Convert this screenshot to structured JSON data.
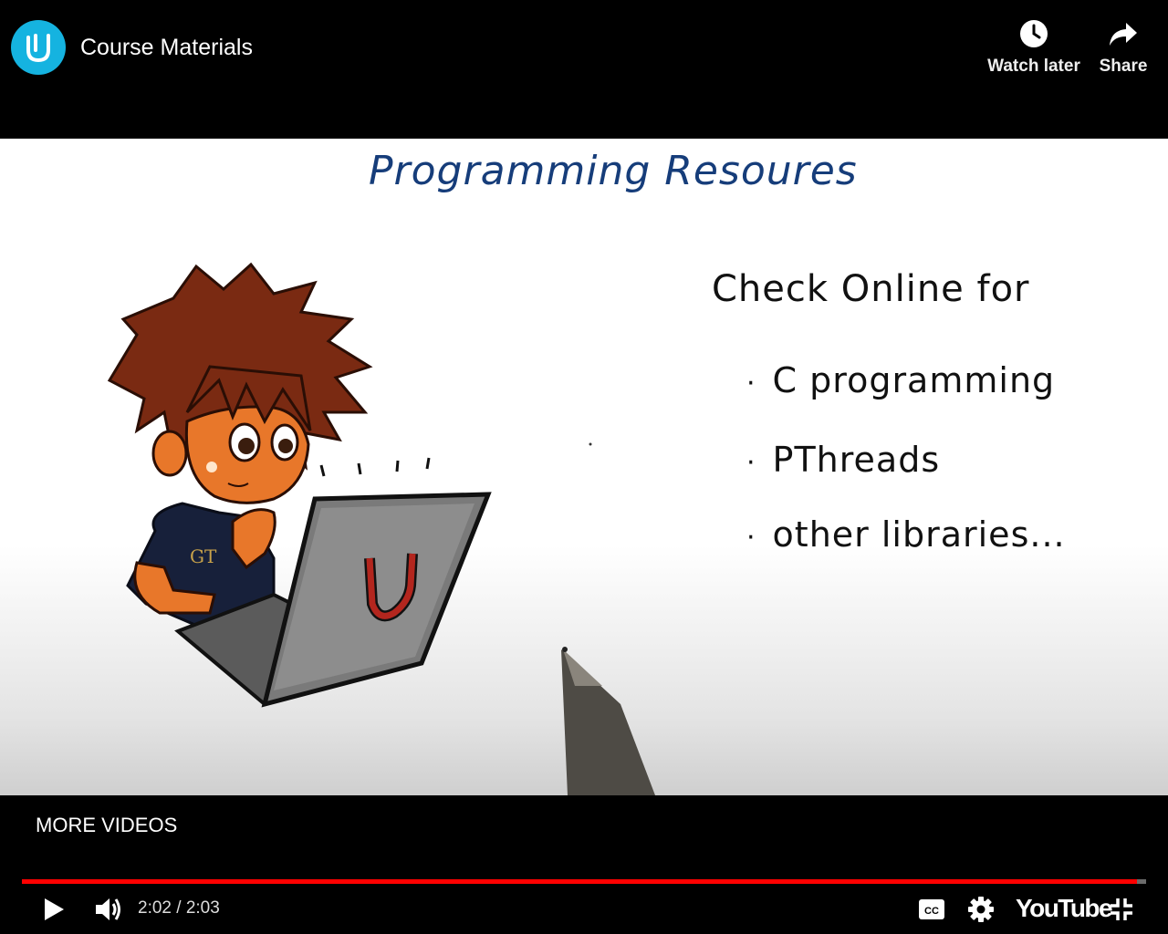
{
  "header": {
    "title": "Course Materials",
    "channel_logo_icon": "udacity-logo-icon",
    "watch_later_label": "Watch later",
    "share_label": "Share"
  },
  "slide": {
    "heading": "Programming Resoures",
    "intro": "Check Online for",
    "bullets": [
      "C programming",
      "PThreads",
      "other libraries..."
    ],
    "laptop_logo": "U",
    "shirt_text": "GT"
  },
  "bottom": {
    "more_videos_label": "MORE VIDEOS",
    "current_time": "2:02",
    "duration": "2:03",
    "progress": 0.992,
    "logo_text": "YouTube"
  },
  "colors": {
    "accent": "#ff0000",
    "udacity_blue": "#15b3e0",
    "heading_ink": "#163d7a"
  }
}
